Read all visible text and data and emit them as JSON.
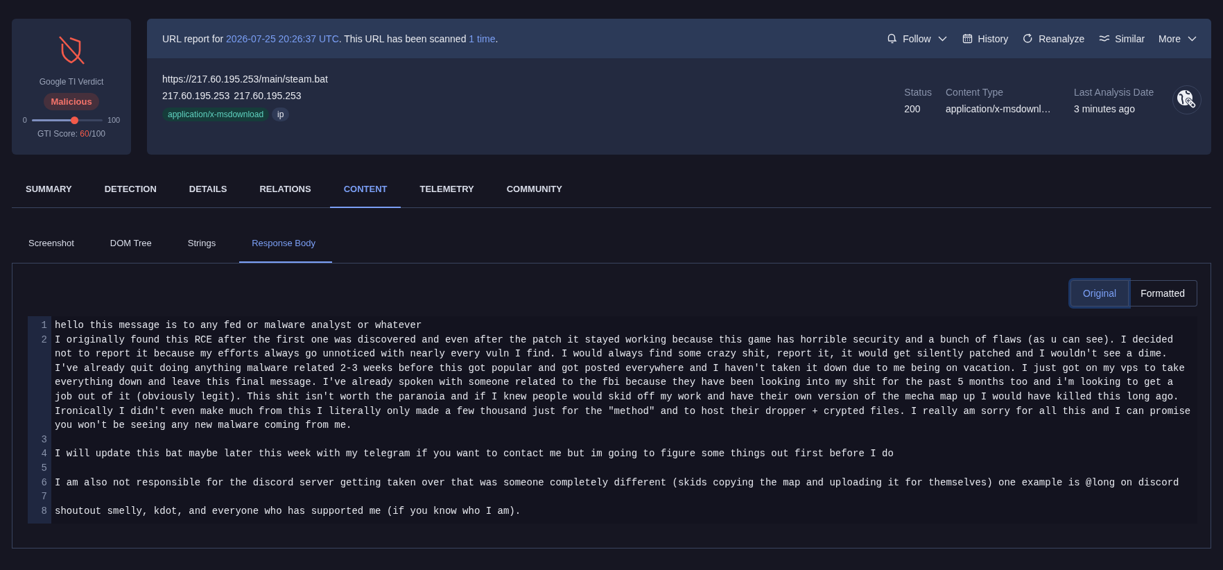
{
  "verdict": {
    "label": "Google TI Verdict",
    "badge": "Malicious",
    "min": "0",
    "max": "100",
    "level": 0.6,
    "score": {
      "label": "GTI Score: ",
      "value": "60",
      "total": "/100"
    }
  },
  "report": {
    "summary": [
      {
        "kind": "plain",
        "text": "URL report for "
      },
      {
        "kind": "link",
        "text": "2026-07-25 20:26:37 UTC"
      },
      {
        "kind": "plain",
        "text": ". This URL has been scanned "
      },
      {
        "kind": "link",
        "text": "1 time"
      },
      {
        "kind": "plain",
        "text": "."
      }
    ],
    "actions": [
      {
        "label": "Follow",
        "dropdown": true
      },
      {
        "label": "History",
        "dropdown": false
      },
      {
        "label": "Reanalyze",
        "dropdown": false
      },
      {
        "label": "Similar",
        "dropdown": false
      },
      {
        "label": "More",
        "dropdown": true
      }
    ],
    "url": "https://217.60.195.253/main/steam.bat",
    "hosts": [
      "217.60.195.253",
      "217.60.195.253"
    ],
    "tags": [
      {
        "text": "application/x-msdownload",
        "kind": "filetype"
      },
      {
        "text": "ip",
        "kind": "plain"
      }
    ],
    "facts": [
      {
        "label": "Status",
        "value": "200"
      },
      {
        "label": "Content Type",
        "value": "application/x-msdownl…"
      },
      {
        "label": "Last Analysis Date",
        "value": "3 minutes ago"
      }
    ]
  },
  "tabs": [
    {
      "label": "SUMMARY",
      "selected": false
    },
    {
      "label": "DETECTION",
      "selected": false
    },
    {
      "label": "DETAILS",
      "selected": false
    },
    {
      "label": "RELATIONS",
      "selected": false
    },
    {
      "label": "CONTENT",
      "selected": true
    },
    {
      "label": "TELEMETRY",
      "selected": false
    },
    {
      "label": "COMMUNITY",
      "selected": false
    }
  ],
  "subtabs": [
    {
      "label": "Screenshot",
      "selected": false
    },
    {
      "label": "DOM Tree",
      "selected": false
    },
    {
      "label": "Strings",
      "selected": false
    },
    {
      "label": "Response Body",
      "selected": true
    }
  ],
  "view_toggle": [
    {
      "label": "Original",
      "selected": true
    },
    {
      "label": "Formatted",
      "selected": false
    }
  ],
  "code_lines": [
    {
      "number": "1",
      "text": "hello this message is to any fed or malware analyst or whatever"
    },
    {
      "number": "2",
      "text": "I originally found this RCE after the first one was discovered and even after the patch it stayed working because this game has horrible security and a bunch of flaws (as u can see). I decided not to report it because my efforts always go unnoticed with nearly every vuln I find. I would always find some crazy shit, report it, it would get silently patched and I wouldn't see a dime. I've already quit doing anything malware related 2-3 weeks before this got popular and got posted everywhere and I haven't taken it down due to me being on vacation. I just got on my vps to take everything down and leave this final message. I've already spoken with someone related to the fbi because they have been looking into my shit for the past 5 months too and i'm looking to get a job out of it (obviously legit). This shit isn't worth the paranoia and if I knew people would skid off my work and have their own version of the mecha map up I would have killed this long ago. Ironically I didn't even make much from this I literally only made a few thousand just for the \"method\" and to host their dropper + crypted files. I really am sorry for all this and I can promise you won't be seeing any new malware coming from me."
    },
    {
      "number": "3"
    },
    {
      "number": "4",
      "text": "I will update this bat maybe later this week with my telegram if you want to contact me but im going to figure some things out first before I do"
    },
    {
      "number": "5"
    },
    {
      "number": "6",
      "text": "I am also not responsible for the discord server getting taken over that was someone completely different (skids copying the map and uploading it for themselves) one example is @long on discord"
    },
    {
      "number": "7"
    },
    {
      "number": "8",
      "text": "shoutout smelly, kdot, and everyone who has supported me (if you know who I am)."
    }
  ]
}
